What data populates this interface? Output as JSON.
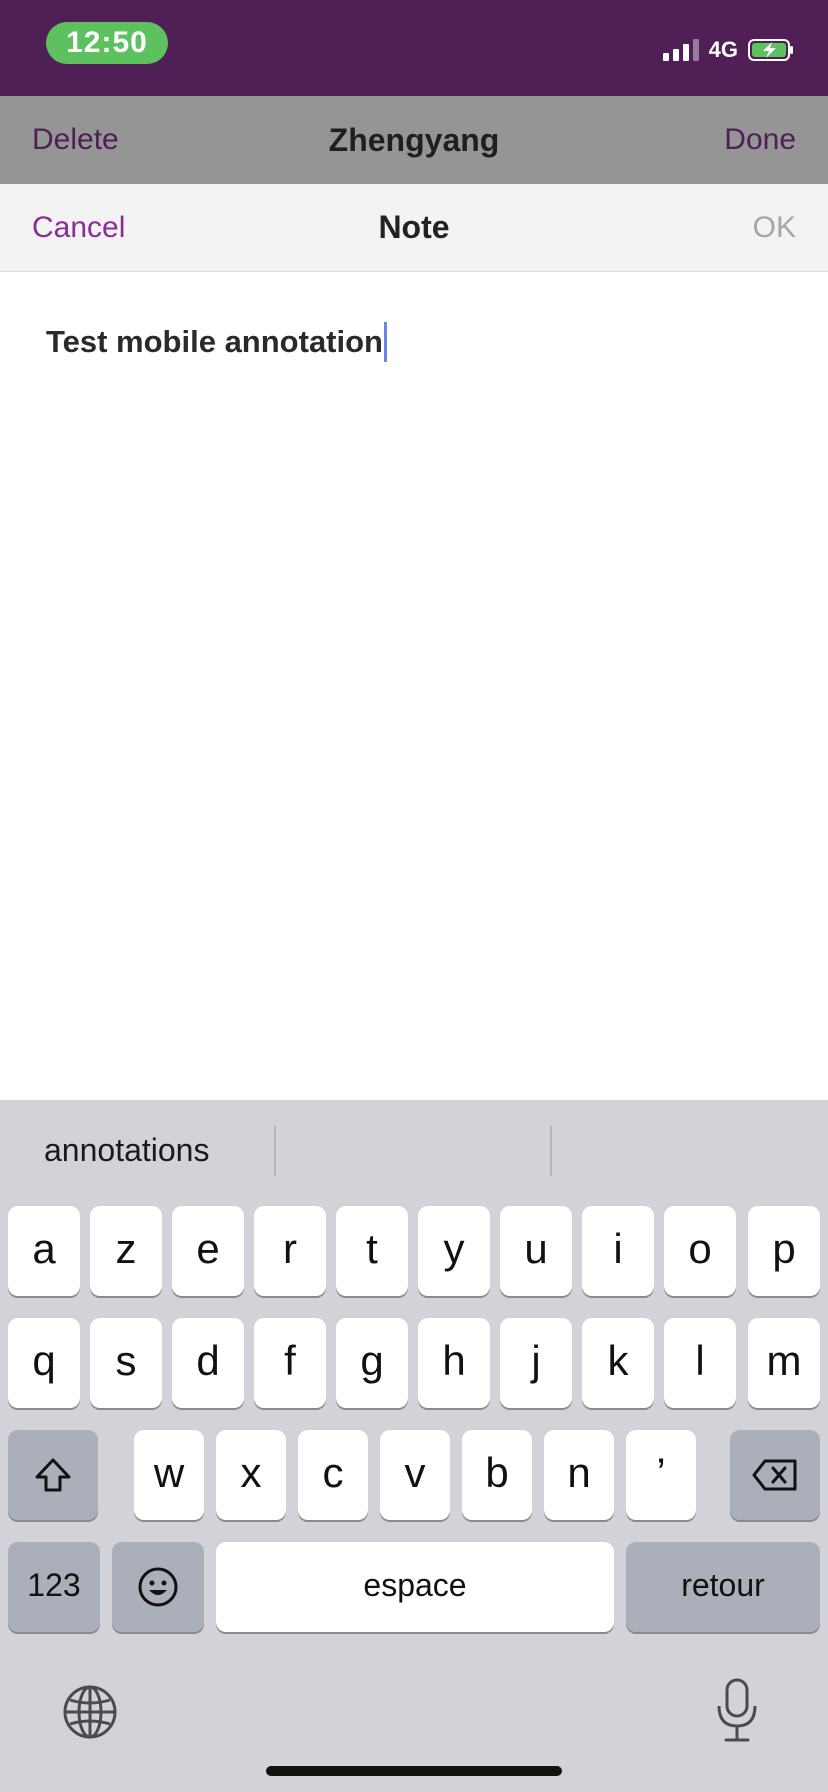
{
  "status_bar": {
    "time": "12:50",
    "network": "4G",
    "colors": {
      "background": "#4f1f56",
      "time_pill": "#5dc160"
    },
    "signal_icon": "signal-bars-icon",
    "battery_icon": "battery-charging-icon"
  },
  "topbar": {
    "left_label": "Delete",
    "title": "Zhengyang",
    "right_label": "Done",
    "colors": {
      "background": "#959595",
      "action": "#4f1f56"
    }
  },
  "note_header": {
    "left_label": "Cancel",
    "title": "Note",
    "right_label": "OK",
    "colors": {
      "background": "#f3f3f3",
      "cancel": "#8b2d96",
      "ok_disabled": "#a6a6a6"
    }
  },
  "note": {
    "text": "Test mobile annotation"
  },
  "keyboard": {
    "suggestions": [
      "annotations",
      "",
      ""
    ],
    "rows": [
      [
        "a",
        "z",
        "e",
        "r",
        "t",
        "y",
        "u",
        "i",
        "o",
        "p"
      ],
      [
        "q",
        "s",
        "d",
        "f",
        "g",
        "h",
        "j",
        "k",
        "l",
        "m"
      ],
      [
        "w",
        "x",
        "c",
        "v",
        "b",
        "n",
        "’"
      ]
    ],
    "numbers_label": "123",
    "space_label": "espace",
    "return_label": "retour",
    "icons": [
      "shift-icon",
      "backspace-icon",
      "emoji-icon",
      "globe-icon",
      "microphone-icon"
    ]
  }
}
